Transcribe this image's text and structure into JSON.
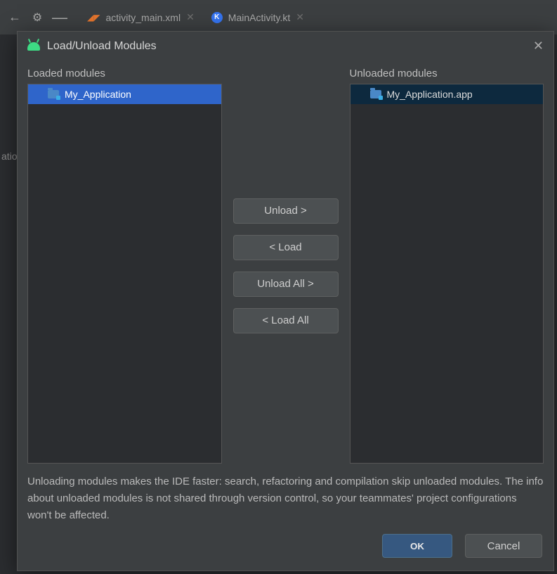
{
  "tabs": [
    {
      "label": "activity_main.xml",
      "active": false
    },
    {
      "label": "MainActivity.kt",
      "active": false
    }
  ],
  "side_label": "atio",
  "dialog": {
    "title": "Load/Unload Modules",
    "loaded_label": "Loaded modules",
    "unloaded_label": "Unloaded modules",
    "loaded_items": [
      {
        "label": "My_Application"
      }
    ],
    "unloaded_items": [
      {
        "label": "My_Application.app"
      }
    ],
    "buttons": {
      "unload": "Unload >",
      "load": "< Load",
      "unload_all": "Unload All >",
      "load_all": "< Load All"
    },
    "help": "Unloading modules makes the IDE faster: search, refactoring and compilation skip unloaded modules. The info about unloaded modules is not shared through version control, so your teammates' project configurations won't be affected.",
    "ok": "OK",
    "cancel": "Cancel"
  }
}
